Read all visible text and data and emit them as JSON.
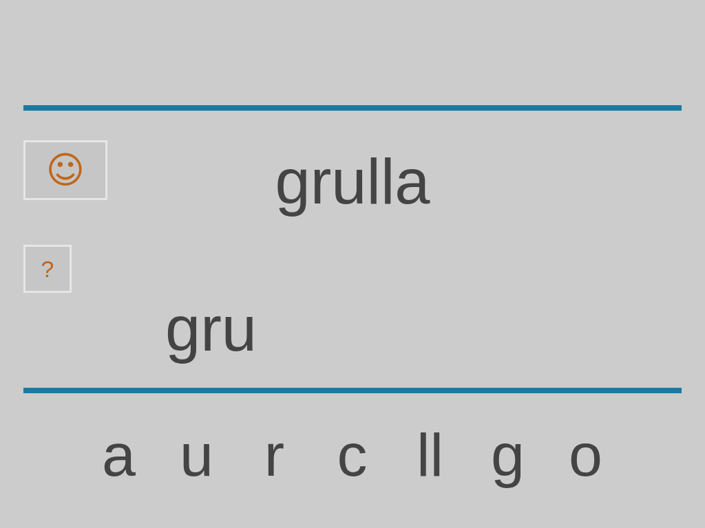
{
  "answer_button": {
    "label": "☺"
  },
  "target_word": "grulla",
  "hint_button": {
    "label": "?"
  },
  "typed_text": "gru",
  "letters": [
    "a",
    "u",
    "r",
    "c",
    "ll",
    "g",
    "o"
  ]
}
